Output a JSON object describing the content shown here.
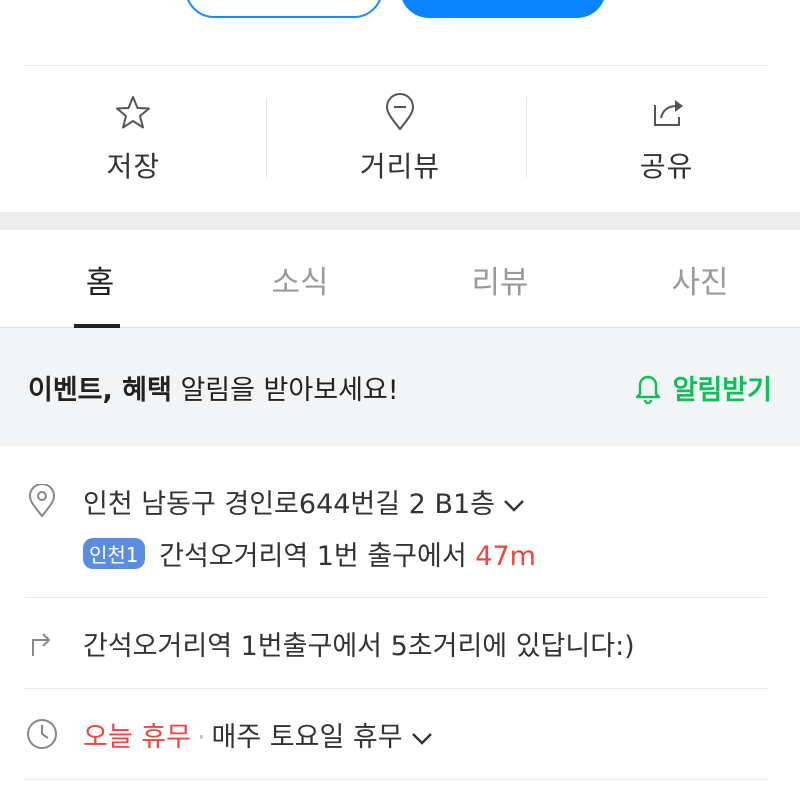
{
  "actions": [
    {
      "label": "저장",
      "icon": "star-icon"
    },
    {
      "label": "거리뷰",
      "icon": "map-pin-icon"
    },
    {
      "label": "공유",
      "icon": "share-icon"
    }
  ],
  "tabs": [
    "홈",
    "소식",
    "리뷰",
    "사진"
  ],
  "notice": {
    "bold_text": "이벤트, 혜택",
    "text": " 알림을 받아보세요!",
    "action_label": "알림받기"
  },
  "address": {
    "text": "인천 남동구 경인로644번길 2 B1층",
    "line_badge": "인천1",
    "station_text": " 간석오거리역 1번 출구에서 ",
    "distance": "47m"
  },
  "directions": {
    "text": "간석오거리역 1번출구에서 5초거리에 있답니다:)"
  },
  "hours": {
    "status": "오늘 휴무",
    "detail": "매주 토요일 휴무"
  },
  "colors": {
    "primary": "#0a84ff",
    "accent_green": "#0fbf5a",
    "alert_red": "#f0453f",
    "badge_blue": "#5a8de0"
  }
}
